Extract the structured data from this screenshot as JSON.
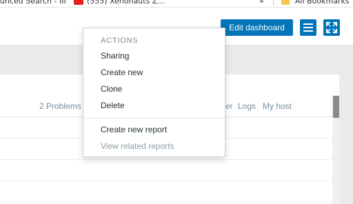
{
  "bookmarks_bar": {
    "item1_label": "unced Search - III",
    "item2_label": "(555) Xenonauts Z...",
    "more_label": "»",
    "all_bookmarks_label": "All Bookmarks"
  },
  "header": {
    "edit_dashboard_label": "Edit dashboard",
    "menu_icon": "hamburger-menu-icon",
    "fullscreen_icon": "fullscreen-icon",
    "accent_color": "#0275b8"
  },
  "widget": {
    "columns": [
      "2 Problems",
      "er",
      "Logs",
      "My host"
    ]
  },
  "actions_menu": {
    "section_label": "ACTIONS",
    "items": [
      "Sharing",
      "Create new",
      "Clone",
      "Delete"
    ],
    "report_items": [
      "Create new report",
      "View related reports"
    ]
  }
}
